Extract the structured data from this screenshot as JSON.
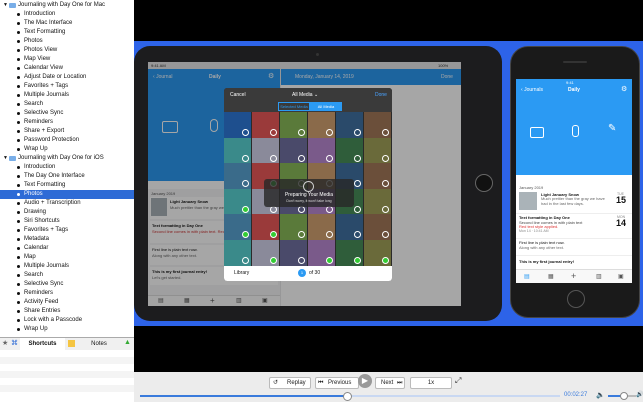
{
  "sidebar": {
    "groups": [
      {
        "title": "Journaling with Day One for Mac",
        "expanded": true,
        "items": [
          "Introduction",
          "The Mac Interface",
          "Text Formatting",
          "Photos",
          "Photos View",
          "Map View",
          "Calendar View",
          "Adjust Date or Location",
          "Favorites + Tags",
          "Multiple Journals",
          "Search",
          "Selective Sync",
          "Reminders",
          "Share + Export",
          "Password Protection",
          "Wrap Up"
        ]
      },
      {
        "title": "Journaling with Day One for iOS",
        "expanded": true,
        "items": [
          "Introduction",
          "The Day One Interface",
          "Text Formatting",
          "Photos",
          "Audio + Transcription",
          "Drawing",
          "Siri Shortcuts",
          "Favorites + Tags",
          "Metadata",
          "Calendar",
          "Map",
          "Multiple Journals",
          "Search",
          "Selective Sync",
          "Reminders",
          "Activity Feed",
          "Share Entries",
          "Lock with a Passcode",
          "Wrap Up"
        ]
      }
    ],
    "selected_group": 1,
    "selected_item": 3,
    "tabs": {
      "shortcuts": "Shortcuts",
      "notes": "Notes"
    }
  },
  "ipad": {
    "time": "9:41 AM",
    "battery": "100%",
    "left_nav": {
      "back": "Journal",
      "title": "Daily"
    },
    "header_date": "Monday, January 14, 2019",
    "header_done": "Done",
    "month": "January 2019",
    "entries": [
      {
        "title": "Light January Snow",
        "body": "Much prettier than the gray we have had in the last few days."
      },
      {
        "title": "Text formatting in Day One",
        "body": "Second line comes in with plain text. Red text style applied."
      },
      {
        "title": "First line is plain text now.",
        "body": "Along with any other text."
      },
      {
        "title": "This is my first journal entry!",
        "body": "Let's get started."
      }
    ],
    "picker": {
      "cancel": "Cancel",
      "title": "All Media",
      "done": "Done",
      "seg_selected": "Selected Media",
      "seg_all": "All Media",
      "overlay_title": "Preparing Your Media",
      "overlay_sub": "Don't worry, it won't take long",
      "footer_library": "Library",
      "footer_count": "of 30",
      "footer_current": "1"
    }
  },
  "iphone": {
    "time": "9:41",
    "nav_back": "Journals",
    "nav_title": "Daily",
    "month": "January 2019",
    "entries": [
      {
        "title": "Light January Snow",
        "body": "Much prettier than the gray we have had in the last few days.",
        "meta": "Wed Jan 15 · 7:30 AM",
        "day": "15",
        "dow": "TUE"
      },
      {
        "title": "Text formatting in Day One",
        "body": "Second line comes in with plain text",
        "red": "Red text style applied.",
        "meta": "Mon 14 · 10:41 AM",
        "day": "14",
        "dow": "MON"
      },
      {
        "title": "First line is plain text now.",
        "body": "Along with any other text.",
        "meta": "",
        "day": "",
        "dow": ""
      },
      {
        "title": "This is my first journal entry!",
        "body": "",
        "meta": "",
        "day": "",
        "dow": ""
      }
    ]
  },
  "controls": {
    "replay": "Replay",
    "previous": "Previous",
    "next": "Next",
    "speed": "1x",
    "time": "00:02:27"
  },
  "progress_fraction": 0.49,
  "volume_fraction": 0.55,
  "colors": {
    "accent": "#2e6bd6",
    "band": "#2d63e8",
    "dayone_blue": "#2b9af3"
  }
}
